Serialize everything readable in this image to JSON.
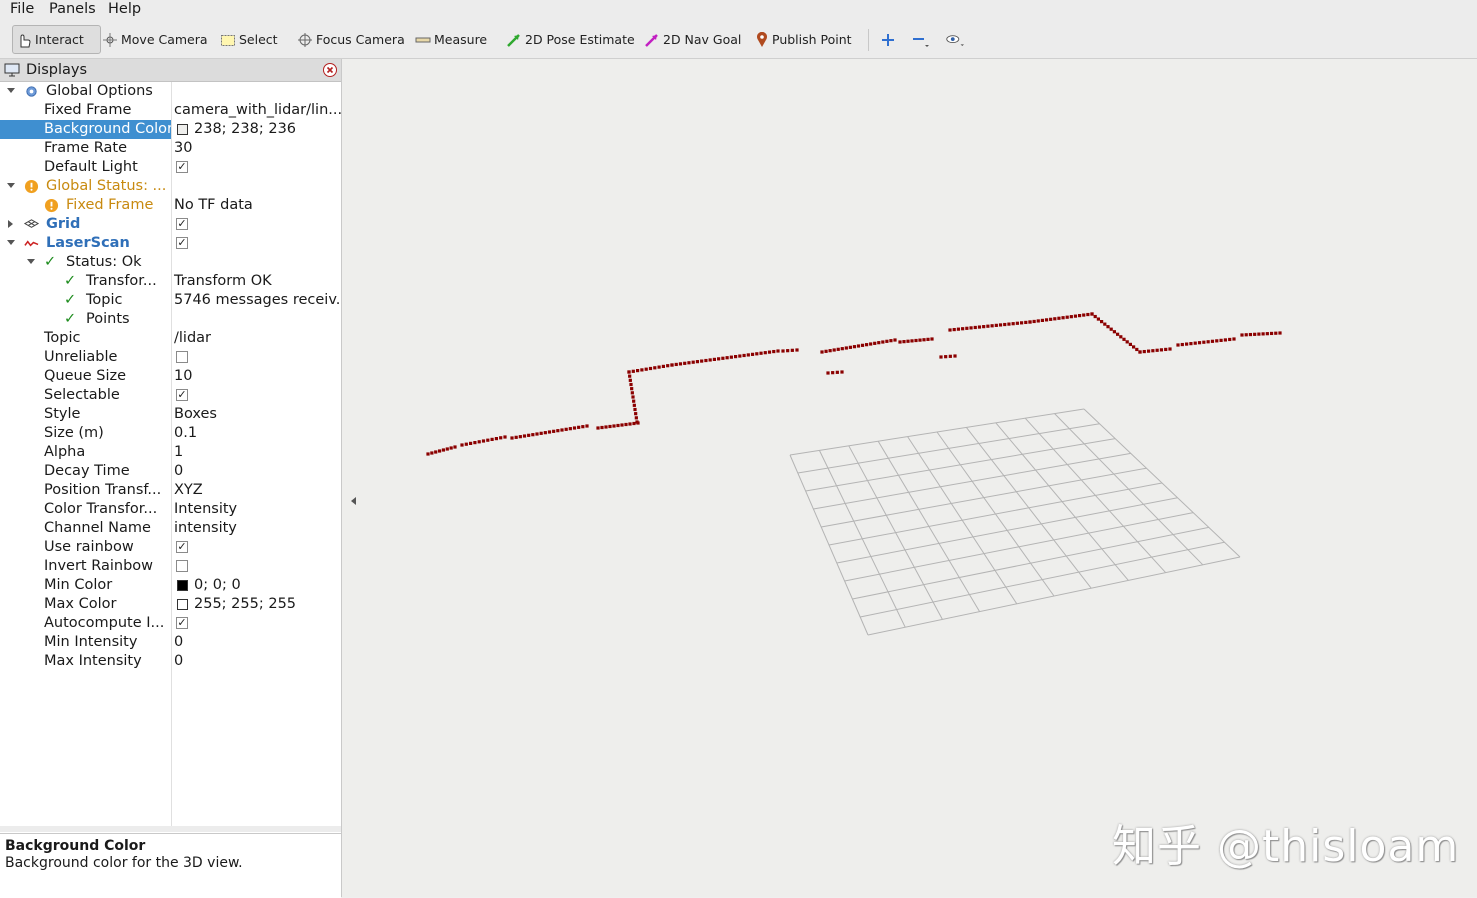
{
  "menu": [
    {
      "label": "File"
    },
    {
      "label": "Panels"
    },
    {
      "label": "Help"
    }
  ],
  "toolbar": {
    "interact": "Interact",
    "move_camera": "Move Camera",
    "select": "Select",
    "focus_camera": "Focus Camera",
    "measure": "Measure",
    "pose_estimate": "2D Pose Estimate",
    "nav_goal": "2D Nav Goal",
    "publish_point": "Publish Point"
  },
  "panel": {
    "title": "Displays"
  },
  "tree": [
    {
      "label": "Global Options",
      "value": ""
    },
    {
      "label": "Fixed Frame",
      "value": "camera_with_lidar/lin..."
    },
    {
      "label": "Background Color",
      "value": "238; 238; 236",
      "swatch": "#eeeeec"
    },
    {
      "label": "Frame Rate",
      "value": "30"
    },
    {
      "label": "Default Light",
      "check": true
    },
    {
      "label": "Global Status: ...",
      "value": ""
    },
    {
      "label": "Fixed Frame",
      "value": "No TF data"
    },
    {
      "label": "Grid",
      "check": true
    },
    {
      "label": "LaserScan",
      "check": true
    },
    {
      "label": "Status: Ok",
      "value": ""
    },
    {
      "label": "Transfor...",
      "value": "Transform OK"
    },
    {
      "label": "Topic",
      "value": "5746 messages receiv..."
    },
    {
      "label": "Points",
      "value": ""
    },
    {
      "label": "Topic",
      "value": "/lidar"
    },
    {
      "label": "Unreliable",
      "check": false
    },
    {
      "label": "Queue Size",
      "value": "10"
    },
    {
      "label": "Selectable",
      "check": true
    },
    {
      "label": "Style",
      "value": "Boxes"
    },
    {
      "label": "Size (m)",
      "value": "0.1"
    },
    {
      "label": "Alpha",
      "value": "1"
    },
    {
      "label": "Decay Time",
      "value": "0"
    },
    {
      "label": "Position Transf...",
      "value": "XYZ"
    },
    {
      "label": "Color Transfor...",
      "value": "Intensity"
    },
    {
      "label": "Channel Name",
      "value": "intensity"
    },
    {
      "label": "Use rainbow",
      "check": true
    },
    {
      "label": "Invert Rainbow",
      "check": false
    },
    {
      "label": "Min Color",
      "value": "0; 0; 0",
      "swatch": "#000000"
    },
    {
      "label": "Max Color",
      "value": "255; 255; 255",
      "swatch": "#ffffff"
    },
    {
      "label": "Autocompute I...",
      "check": true
    },
    {
      "label": "Min Intensity",
      "value": "0"
    },
    {
      "label": "Max Intensity",
      "value": "0"
    }
  ],
  "help": {
    "title": "Background Color",
    "text": "Background color for the 3D view."
  },
  "view": {
    "watermark": "知乎 @thisloam",
    "background": "#eeeeec",
    "scan_color": "#8b0000",
    "grid_color": "#b4b4b4"
  }
}
